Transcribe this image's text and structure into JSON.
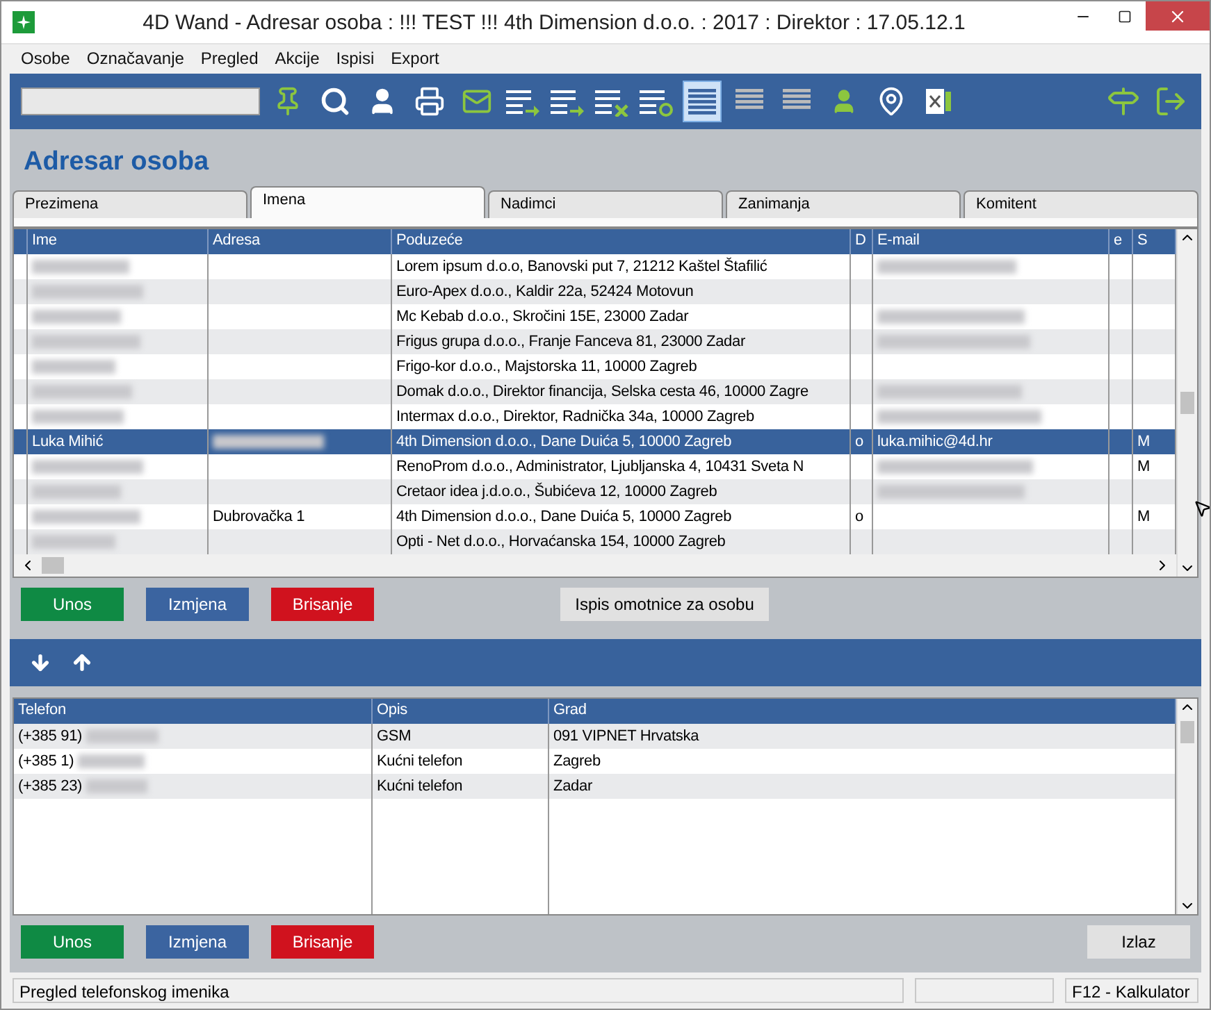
{
  "window": {
    "title": "4D Wand - Adresar osoba : !!! TEST !!! 4th Dimension d.o.o. : 2017 : Direktor : 17.05.12.1"
  },
  "menu": [
    "Osobe",
    "Označavanje",
    "Pregled",
    "Akcije",
    "Ispisi",
    "Export"
  ],
  "toolbar": {
    "views": [
      {
        "selected": true
      },
      {
        "selected": false
      },
      {
        "selected": false
      }
    ]
  },
  "heading": "Adresar osoba",
  "tabs": [
    {
      "label": "Prezimena",
      "selected": false
    },
    {
      "label": "Imena",
      "selected": true
    },
    {
      "label": "Nadimci",
      "selected": false
    },
    {
      "label": "Zanimanja",
      "selected": false
    },
    {
      "label": "Komitent",
      "selected": false
    }
  ],
  "table": {
    "columns": [
      "Ime",
      "Adresa",
      "Poduzeće",
      "D",
      "E-mail",
      "e",
      "S"
    ],
    "rows": [
      {
        "selected": false,
        "cells": [
          {
            "blurred": true
          },
          "",
          "Lorem ipsum d.o.o, Banovski put 7, 21212 Kaštel Štafilić",
          "",
          {
            "blurred": true
          },
          "",
          ""
        ]
      },
      {
        "selected": false,
        "cells": [
          {
            "blurred": true
          },
          "",
          "Euro-Apex d.o.o., Kaldir 22a, 52424 Motovun",
          "",
          "",
          "",
          ""
        ]
      },
      {
        "selected": false,
        "cells": [
          {
            "blurred": true
          },
          "",
          "Mc Kebab d.o.o., Skročini 15E, 23000 Zadar",
          "",
          {
            "blurred": true
          },
          "",
          ""
        ]
      },
      {
        "selected": false,
        "cells": [
          {
            "blurred": true
          },
          "",
          "Frigus grupa d.o.o., Franje Fanceva 81, 23000 Zadar",
          "",
          {
            "blurred": true
          },
          "",
          ""
        ]
      },
      {
        "selected": false,
        "cells": [
          {
            "blurred": true
          },
          "",
          "Frigo-kor d.o.o., Majstorska 11, 10000 Zagreb",
          "",
          "",
          "",
          ""
        ]
      },
      {
        "selected": false,
        "cells": [
          {
            "blurred": true
          },
          "",
          "Domak d.o.o., Direktor financija, Selska cesta 46, 10000 Zagre",
          "",
          {
            "blurred": true
          },
          "",
          ""
        ]
      },
      {
        "selected": false,
        "cells": [
          {
            "blurred": true
          },
          "",
          "Intermax d.o.o., Direktor, Radnička 34a, 10000 Zagreb",
          "",
          {
            "blurred": true
          },
          "",
          ""
        ]
      },
      {
        "selected": true,
        "cells": [
          "Luka Mihić",
          {
            "blurred": true
          },
          "4th Dimension d.o.o., Dane Duića 5, 10000 Zagreb",
          "o",
          "luka.mihic@4d.hr",
          "",
          "M"
        ]
      },
      {
        "selected": false,
        "cells": [
          {
            "blurred": true
          },
          "",
          "RenoProm d.o.o., Administrator, Ljubljanska 4, 10431 Sveta N",
          "",
          {
            "blurred": true
          },
          "",
          "M"
        ]
      },
      {
        "selected": false,
        "cells": [
          {
            "blurred": true
          },
          "",
          "Cretaor idea j.d.o.o., Šubićeva 12, 10000 Zagreb",
          "",
          {
            "blurred": true
          },
          "",
          ""
        ]
      },
      {
        "selected": false,
        "cells": [
          {
            "blurred": true
          },
          "Dubrovačka 1",
          "4th Dimension d.o.o., Dane Duića 5, 10000 Zagreb",
          "o",
          "",
          "",
          "M"
        ]
      },
      {
        "selected": false,
        "cells": [
          {
            "blurred": true
          },
          "",
          "Opti - Net d.o.o., Horvaćanska 154, 10000 Zagreb",
          "",
          "",
          "",
          ""
        ]
      }
    ]
  },
  "actions": [
    {
      "label": "Unos",
      "kind": "add"
    },
    {
      "label": "Izmjena",
      "kind": "edit"
    },
    {
      "label": "Brisanje",
      "kind": "delete"
    }
  ],
  "print_button": "Ispis omotnice za osobu",
  "phones": {
    "columns": [
      "Telefon",
      "Opis",
      "Grad"
    ],
    "rows": [
      {
        "prefix": "(+385 91)",
        "blurred": true,
        "opis": "GSM",
        "grad": "091 VIPNET Hrvatska"
      },
      {
        "prefix": "(+385 1)",
        "blurred": true,
        "opis": "Kućni telefon",
        "grad": "Zagreb"
      },
      {
        "prefix": "(+385 23)",
        "blurred": true,
        "opis": "Kućni telefon",
        "grad": "Zadar"
      }
    ]
  },
  "phone_actions": [
    {
      "label": "Unos",
      "kind": "add"
    },
    {
      "label": "Izmjena",
      "kind": "edit"
    },
    {
      "label": "Brisanje",
      "kind": "delete"
    }
  ],
  "exit_button": "Izlaz",
  "status_bar": {
    "message": "Pregled telefonskog imenika",
    "shortcut": "F12 - Kalkulator"
  }
}
